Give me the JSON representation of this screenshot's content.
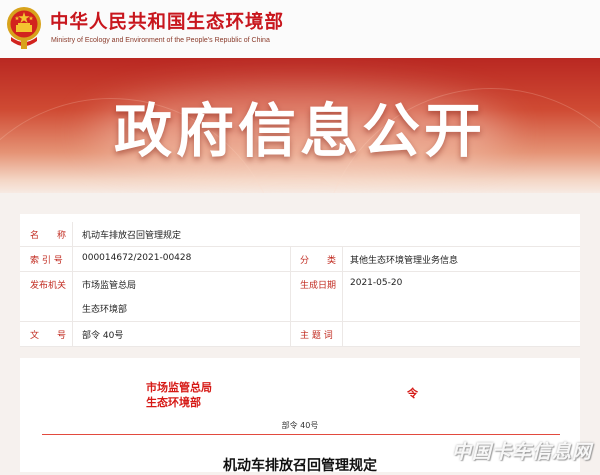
{
  "header": {
    "title": "中华人民共和国生态环境部",
    "subtitle": "Ministry of Ecology and Environment of the People's Republic of China"
  },
  "banner": {
    "title": "政府信息公开"
  },
  "info": {
    "name_label": "名　　称",
    "name_value": "机动车排放召回管理规定",
    "index_label": "索 引 号",
    "index_value": "000014672/2021-00428",
    "category_label": "分　　类",
    "category_value": "其他生态环境管理业务信息",
    "issuer_label": "发布机关",
    "issuer_value_1": "市场监管总局",
    "issuer_value_2": "生态环境部",
    "date_label": "生成日期",
    "date_value": "2021-05-20",
    "docno_label": "文　　号",
    "docno_value": "部令 40号",
    "subject_label": "主 题 词",
    "subject_value": ""
  },
  "document": {
    "org_1": "市场监管总局",
    "org_2": "生态环境部",
    "ling": "令",
    "number": "部令 40号",
    "heading": "机动车排放召回管理规定"
  },
  "watermark": "中国卡车信息网",
  "colors": {
    "brand_red": "#c8161d",
    "label_red": "#c12a1f",
    "doc_red": "#d61a16"
  }
}
